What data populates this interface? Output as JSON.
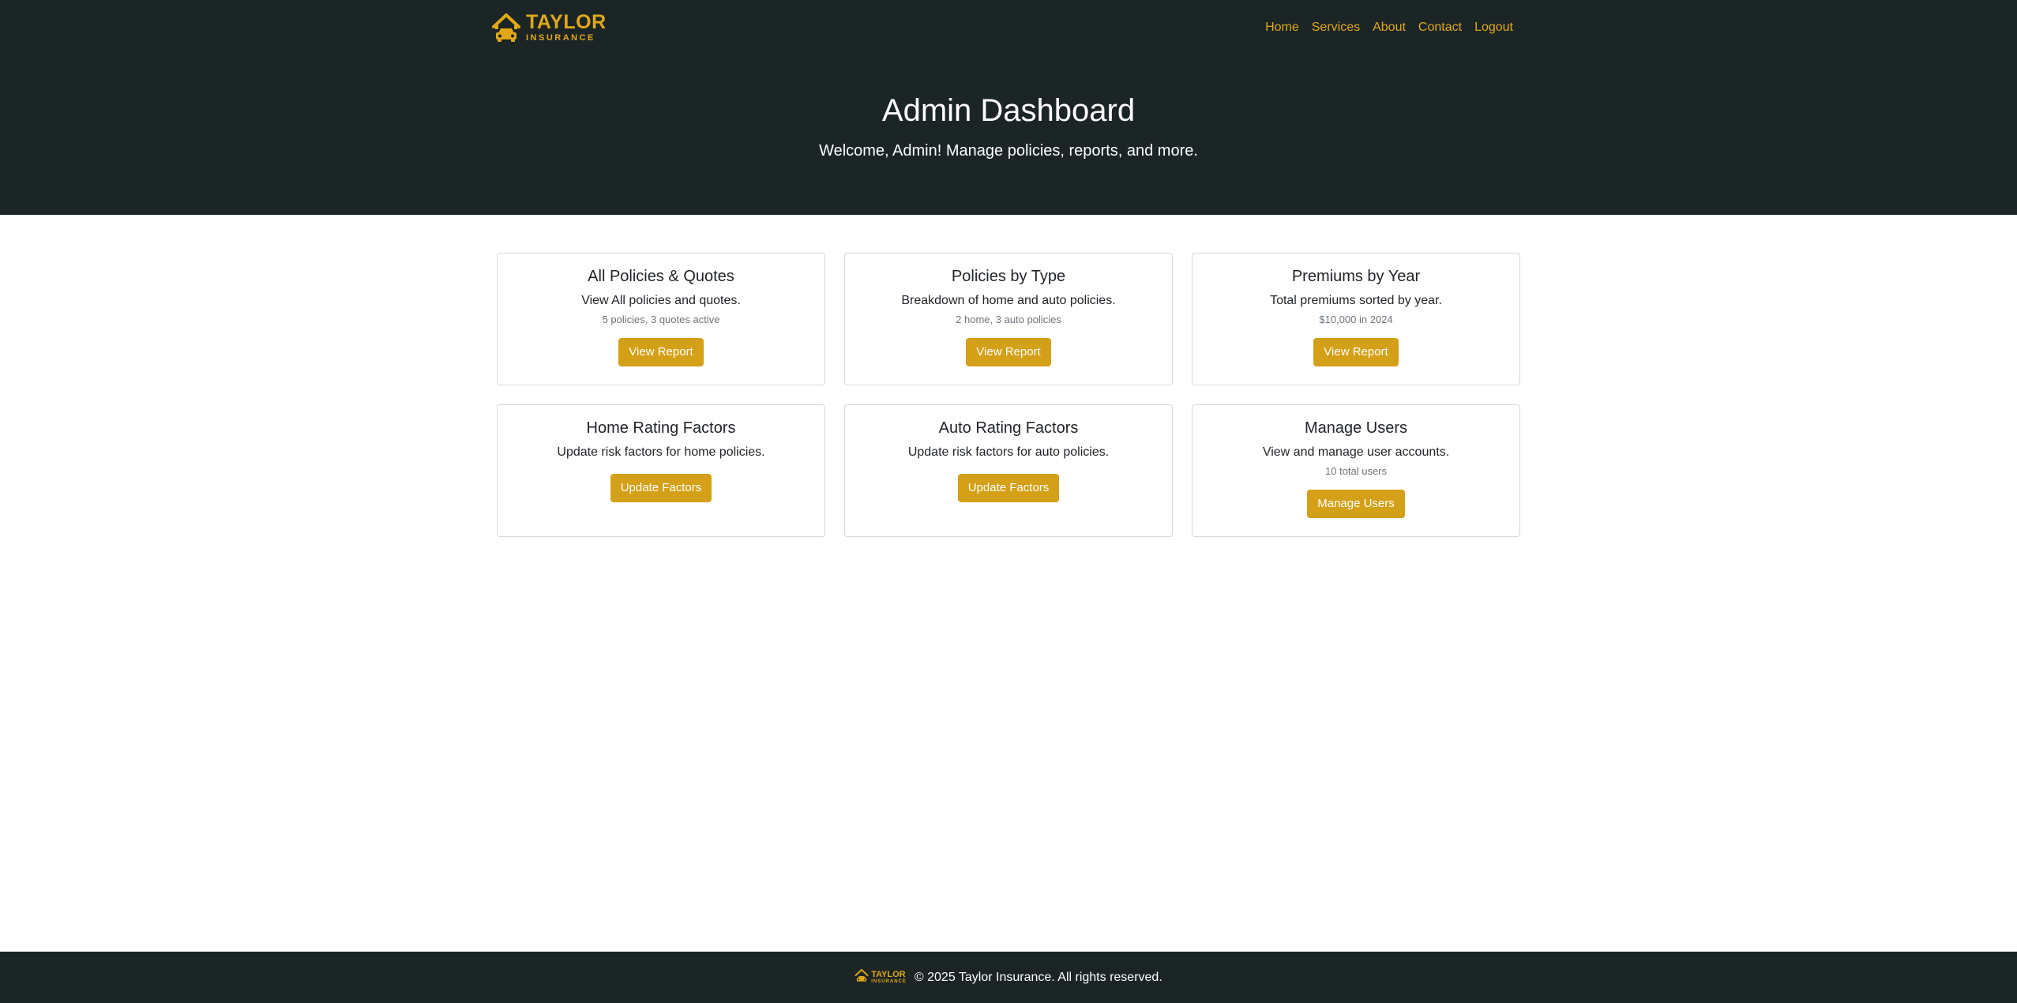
{
  "brand": {
    "line1": "TAYLOR",
    "line2": "INSURANCE",
    "icon": "house-car-icon",
    "color": "#e0a817"
  },
  "nav": {
    "items": [
      {
        "label": "Home"
      },
      {
        "label": "Services"
      },
      {
        "label": "About"
      },
      {
        "label": "Contact"
      },
      {
        "label": "Logout"
      }
    ]
  },
  "hero": {
    "title": "Admin Dashboard",
    "subtitle": "Welcome, Admin! Manage policies, reports, and more."
  },
  "cards": [
    {
      "title": "All Policies & Quotes",
      "description": "View All policies and quotes.",
      "meta": "5 policies, 3 quotes active",
      "button": "View Report"
    },
    {
      "title": "Policies by Type",
      "description": "Breakdown of home and auto policies.",
      "meta": "2 home, 3 auto policies",
      "button": "View Report"
    },
    {
      "title": "Premiums by Year",
      "description": "Total premiums sorted by year.",
      "meta": "$10,000 in 2024",
      "button": "View Report"
    },
    {
      "title": "Home Rating Factors",
      "description": "Update risk factors for home policies.",
      "button": "Update Factors"
    },
    {
      "title": "Auto Rating Factors",
      "description": "Update risk factors for auto policies.",
      "button": "Update Factors"
    },
    {
      "title": "Manage Users",
      "description": "View and manage user accounts.",
      "meta": "10 total users",
      "button": "Manage Users"
    }
  ],
  "footer": {
    "text": "© 2025 Taylor Insurance. All rights reserved."
  },
  "colors": {
    "header_bg": "#1c2526",
    "accent": "#d4a017"
  }
}
